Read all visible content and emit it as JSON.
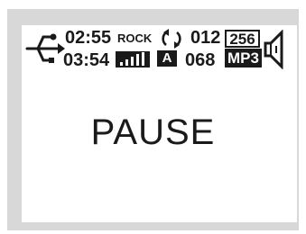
{
  "status": {
    "elapsed_time": "02:55",
    "total_time": "03:54",
    "eq_preset": "ROCK",
    "repeat_icon": "repeat-icon",
    "track_number": "012",
    "track_total": "068",
    "bitrate": "256",
    "format": "MP3",
    "ab_mode": "A",
    "signal_icon": "signal-bars-icon",
    "volume_icon": "speaker-icon",
    "usb_icon": "usb-icon"
  },
  "main": {
    "state_text": "PAUSE"
  },
  "colors": {
    "ink": "#1a1a1a",
    "screen_border": "#d8d8d8",
    "lcd_background": "#ffffff"
  }
}
